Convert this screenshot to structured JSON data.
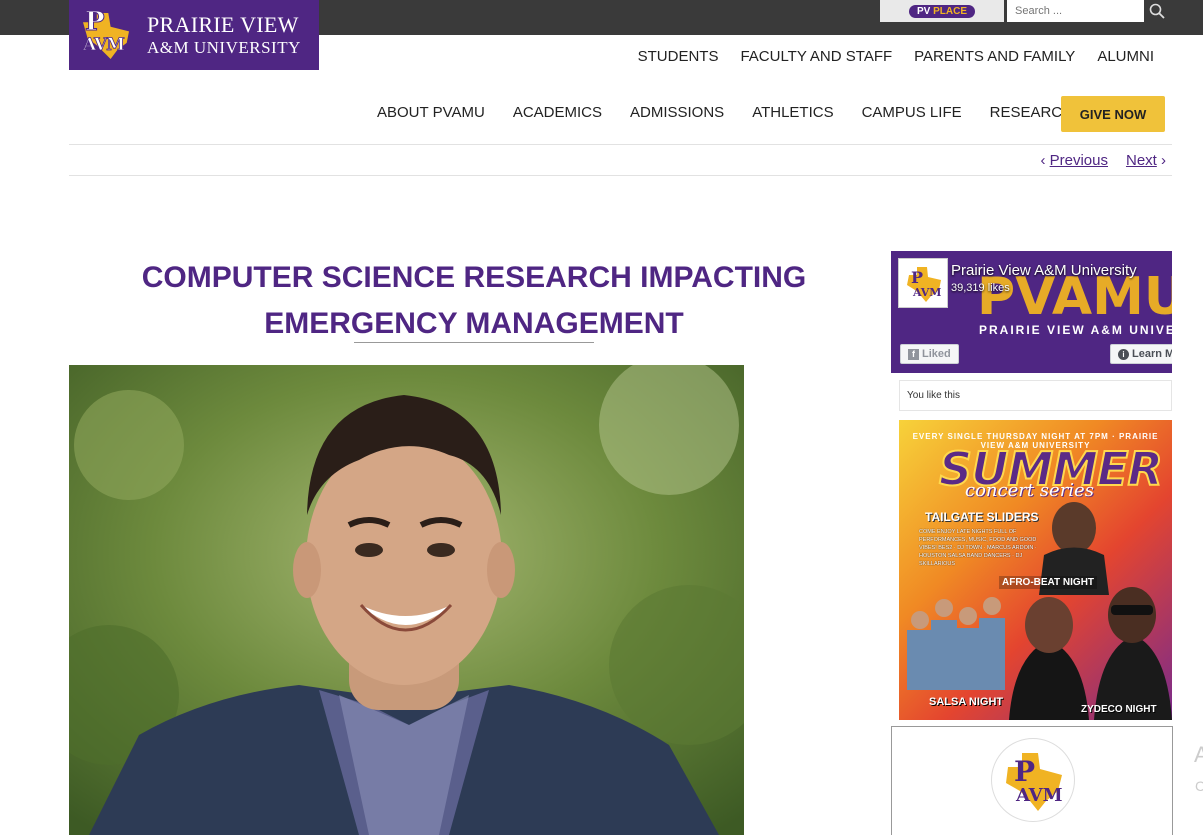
{
  "header": {
    "logo_line1": "Prairie View",
    "logo_line2": "A&M University",
    "pvplace_prefix": "PV",
    "pvplace_suffix": "PLACE",
    "search_placeholder": "Search ...",
    "audience_nav": [
      "Students",
      "Faculty and Staff",
      "Parents and Family",
      "Alumni"
    ],
    "main_nav": [
      "About PVAMU",
      "Academics",
      "Admissions",
      "Athletics",
      "Campus Life",
      "Research"
    ],
    "give_label": "GIVE NOW"
  },
  "pager": {
    "prev_label": "Previous",
    "next_label": "Next",
    "prev_chevron": "‹",
    "next_chevron": "›"
  },
  "article": {
    "title": "COMPUTER SCIENCE RESEARCH IMPACTING EMERGENCY MANAGEMENT"
  },
  "facebook": {
    "page_name": "Prairie View A&M University",
    "likes": "39,319 likes",
    "cover_text": "PVAMU",
    "cover_sub": "PRAIRIE VIEW A&M UNIVERSITY",
    "liked_label": "Liked",
    "learn_label": "Learn More",
    "you_like": "You like this"
  },
  "poster": {
    "top": "EVERY SINGLE THURSDAY NIGHT AT 7PM · PRAIRIE VIEW A&M UNIVERSITY",
    "title": "SUMMER",
    "subtitle": "concert series",
    "headline": "TAILGATE SLIDERS",
    "details": "COME ENJOY LATE NIGHTS FULL OF PERFORMANCES, MUSIC, FOOD AND GOOD VIBES! BES2 · DJ TOWN · MARCUS ARDOIN · HOUSTON SALSA BAND DANCERS · DJ SKILLARIOUS",
    "afro": "AFRO-BEAT NIGHT",
    "salsa": "SALSA NIGHT",
    "zydeco": "ZYDECO NIGHT"
  },
  "colors": {
    "brand_purple": "#4f2683",
    "brand_gold": "#f0b323",
    "give_yellow": "#f0c23a",
    "topbar": "#3a3a3a"
  },
  "icons": {
    "search": "magnifier",
    "facebook": "f-logo",
    "info": "info-circle"
  }
}
